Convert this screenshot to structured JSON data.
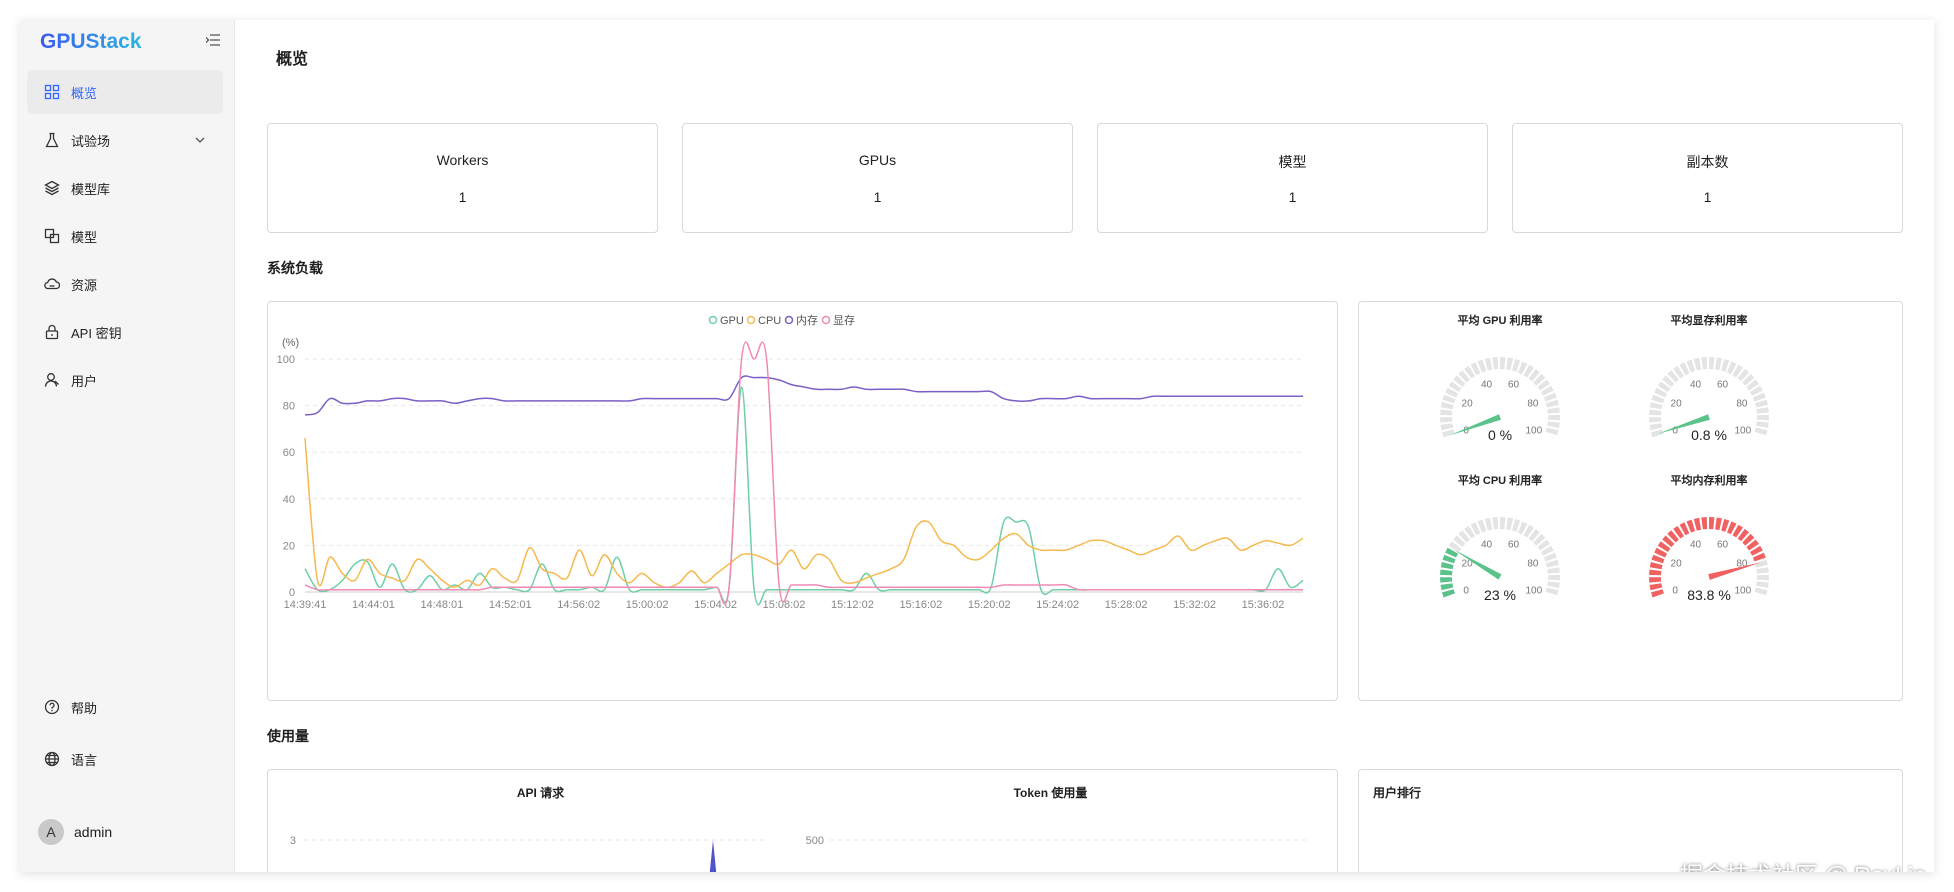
{
  "app": {
    "logo": "GPUStack"
  },
  "sidebar": {
    "items": [
      {
        "label": "概览",
        "icon": "dashboard-icon",
        "active": true
      },
      {
        "label": "试验场",
        "icon": "flask-icon",
        "has_submenu": true
      },
      {
        "label": "模型库",
        "icon": "layers-icon"
      },
      {
        "label": "模型",
        "icon": "model-icon"
      },
      {
        "label": "资源",
        "icon": "cloud-icon"
      },
      {
        "label": "API 密钥",
        "icon": "lock-icon"
      },
      {
        "label": "用户",
        "icon": "user-icon"
      }
    ],
    "bottom_items": [
      {
        "label": "帮助",
        "icon": "help-icon"
      },
      {
        "label": "语言",
        "icon": "globe-icon"
      }
    ],
    "user": {
      "avatar_letter": "A",
      "name": "admin"
    }
  },
  "page": {
    "title": "概览"
  },
  "stats": [
    {
      "label": "Workers",
      "value": "1"
    },
    {
      "label": "GPUs",
      "value": "1"
    },
    {
      "label": "模型",
      "value": "1"
    },
    {
      "label": "副本数",
      "value": "1"
    }
  ],
  "sections": {
    "system_load": "系统负载",
    "usage": "使用量"
  },
  "chart_data": [
    {
      "type": "line",
      "ylabel": "(%)",
      "ylim": [
        0,
        100
      ],
      "yticks": [
        "0",
        "20",
        "40",
        "60",
        "80",
        "100"
      ],
      "x_tick_labels": [
        "14:39:41",
        "14:44:01",
        "14:48:01",
        "14:52:01",
        "14:56:02",
        "15:00:02",
        "15:04:02",
        "15:08:02",
        "15:12:02",
        "15:16:02",
        "15:20:02",
        "15:24:02",
        "15:28:02",
        "15:32:02",
        "15:36:02"
      ],
      "legend_position": "top-center",
      "series": [
        {
          "name": "GPU",
          "color": "#6fcfa5",
          "values": [
            10,
            1,
            1,
            5,
            12,
            13,
            2,
            12,
            1,
            1,
            7,
            1,
            3,
            1,
            8,
            2,
            2,
            1,
            1,
            12,
            1,
            1,
            1,
            2,
            1,
            15,
            1,
            1,
            1,
            1,
            1,
            1,
            1,
            2,
            2,
            88,
            1,
            1,
            1,
            1,
            1,
            1,
            1,
            1,
            1,
            8,
            1,
            1,
            1,
            1,
            1,
            1,
            1,
            1,
            1,
            2,
            30,
            30,
            28,
            1,
            1,
            1,
            1,
            1,
            1,
            1,
            1,
            1,
            1,
            1,
            1,
            1,
            1,
            1,
            1,
            1,
            1,
            1,
            10,
            2,
            5
          ]
        },
        {
          "name": "CPU",
          "color": "#f5b94f",
          "values": [
            66,
            5,
            15,
            8,
            5,
            14,
            8,
            6,
            5,
            14,
            10,
            5,
            2,
            5,
            3,
            10,
            6,
            5,
            19,
            10,
            8,
            6,
            18,
            7,
            16,
            8,
            4,
            8,
            4,
            2,
            4,
            9,
            4,
            8,
            12,
            16,
            16,
            14,
            12,
            18,
            10,
            16,
            14,
            5,
            4,
            6,
            8,
            10,
            14,
            28,
            30,
            22,
            20,
            15,
            14,
            18,
            23,
            25,
            20,
            18,
            18,
            18,
            20,
            22,
            22,
            20,
            18,
            16,
            18,
            20,
            24,
            18,
            20,
            22,
            23,
            18,
            20,
            22,
            21,
            20,
            23
          ]
        },
        {
          "name": "内存",
          "color": "#7b5fc7",
          "values": [
            76,
            77,
            83,
            81,
            81,
            82,
            82,
            83,
            83,
            82,
            82,
            82,
            81,
            82,
            83,
            83,
            82,
            82,
            82,
            82,
            82,
            82,
            82,
            82,
            82,
            82,
            82,
            83,
            83,
            83,
            83,
            83,
            83,
            83,
            83,
            92,
            92,
            92,
            91,
            89,
            88,
            87,
            87,
            87,
            88,
            87,
            87,
            87,
            87,
            86,
            86,
            86,
            86,
            86,
            86,
            86,
            83,
            82,
            82,
            83,
            83,
            83,
            84,
            83,
            83,
            83,
            83,
            83,
            84,
            84,
            84,
            84,
            84,
            84,
            84,
            84,
            84,
            84,
            84,
            84,
            84
          ]
        },
        {
          "name": "显存",
          "color": "#f08ab5",
          "values": [
            3,
            1,
            1,
            1,
            1,
            1,
            1,
            1,
            1,
            1,
            1,
            1,
            1,
            1,
            1,
            2,
            2,
            2,
            2,
            2,
            2,
            2,
            2,
            2,
            2,
            2,
            2,
            2,
            2,
            2,
            2,
            2,
            2,
            2,
            2,
            100,
            100,
            100,
            3,
            3,
            3,
            3,
            2,
            2,
            2,
            2,
            2,
            2,
            2,
            2,
            2,
            2,
            2,
            2,
            2,
            2,
            3,
            3,
            3,
            3,
            3,
            3,
            1,
            1,
            1,
            1,
            1,
            1,
            1,
            1,
            1,
            1,
            1,
            1,
            1,
            1,
            1,
            1,
            1,
            1,
            1
          ]
        }
      ]
    },
    {
      "type": "gauge",
      "gauges": [
        {
          "title": "平均 GPU 利用率",
          "value": 0,
          "display": "0 %",
          "color": "#5bc28b",
          "min": 0,
          "max": 100,
          "ticks": [
            "0",
            "20",
            "40",
            "60",
            "80",
            "100"
          ]
        },
        {
          "title": "平均显存利用率",
          "value": 0.8,
          "display": "0.8 %",
          "color": "#5bc28b",
          "min": 0,
          "max": 100,
          "ticks": [
            "0",
            "20",
            "40",
            "60",
            "80",
            "100"
          ]
        },
        {
          "title": "平均 CPU 利用率",
          "value": 23,
          "display": "23 %",
          "color": "#5bc28b",
          "min": 0,
          "max": 100,
          "ticks": [
            "0",
            "20",
            "40",
            "60",
            "80",
            "100"
          ]
        },
        {
          "title": "平均内存利用率",
          "value": 83.8,
          "display": "83.8 %",
          "color": "#f06262",
          "min": 0,
          "max": 100,
          "ticks": [
            "0",
            "20",
            "40",
            "60",
            "80",
            "100"
          ]
        }
      ]
    },
    {
      "type": "area",
      "title": "API 请求",
      "yticks_visible": [
        "3"
      ]
    },
    {
      "type": "bar",
      "title": "Token 使用量",
      "yticks_visible": [
        "500"
      ]
    }
  ],
  "user_ranking": {
    "title": "用户排行"
  },
  "watermark": "掘金技术社区 @ RoyLin"
}
